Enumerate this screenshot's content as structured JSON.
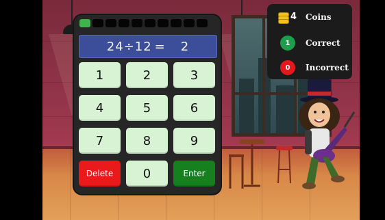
{
  "progress": {
    "total": 10,
    "filled": 1,
    "filled_color": "#3db54a"
  },
  "display": {
    "dividend": "24",
    "operator": "÷",
    "divisor": "12",
    "equals": "=",
    "answer": "2"
  },
  "keypad": {
    "rows": [
      [
        "1",
        "2",
        "3"
      ],
      [
        "4",
        "5",
        "6"
      ],
      [
        "7",
        "8",
        "9"
      ],
      [
        "Delete",
        "0",
        "Enter"
      ]
    ]
  },
  "score": {
    "coins_count": "4",
    "coins_label": "Coins",
    "correct_count": "1",
    "correct_label": "Correct",
    "incorrect_count": "0",
    "incorrect_label": "Incorrect"
  },
  "colors": {
    "key_bg": "#d7f3d4",
    "delete_bg": "#ea1a1a",
    "enter_bg": "#16801e",
    "display_bg": "#3c4e99",
    "correct_badge": "#1e9e4c",
    "incorrect_badge": "#e3171c",
    "coin": "#f2c21b"
  }
}
